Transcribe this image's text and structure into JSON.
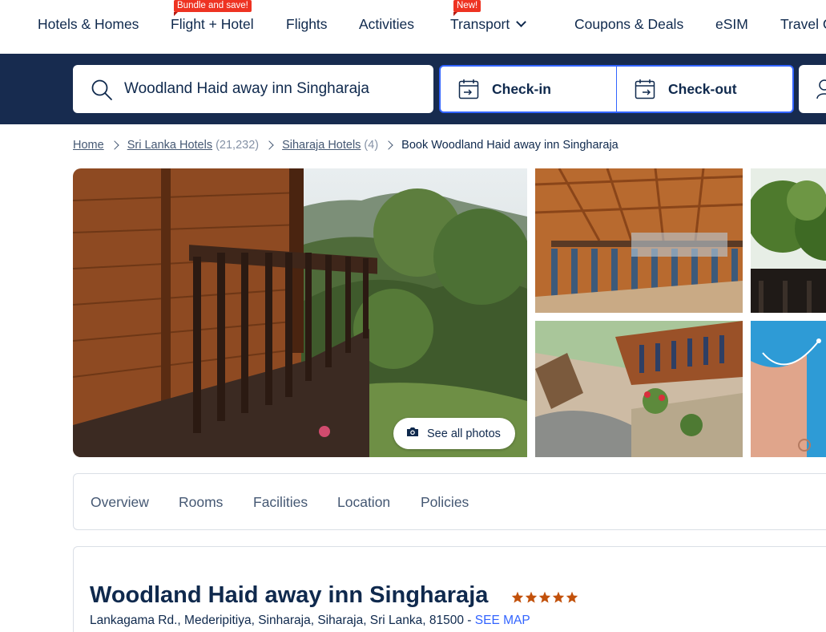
{
  "nav": {
    "items": [
      {
        "label": "Hotels & Homes"
      },
      {
        "label": "Flight + Hotel",
        "badge": "Bundle and save!"
      },
      {
        "label": "Flights"
      },
      {
        "label": "Activities"
      },
      {
        "label": "Transport",
        "badge": "New!"
      },
      {
        "label": "Coupons & Deals"
      },
      {
        "label": "eSIM"
      },
      {
        "label": "Travel C"
      }
    ]
  },
  "search": {
    "destination_value": "Woodland Haid away inn Singharaja",
    "checkin_label": "Check-in",
    "checkout_label": "Check-out"
  },
  "breadcrumb": {
    "home": "Home",
    "country": "Sri Lanka Hotels",
    "country_count": "(21,232)",
    "city": "Siharaja Hotels",
    "city_count": "(4)",
    "current": "Book Woodland Haid away inn Singharaja"
  },
  "gallery": {
    "see_all_label": "See all photos"
  },
  "tabs": [
    "Overview",
    "Rooms",
    "Facilities",
    "Location",
    "Policies"
  ],
  "hotel": {
    "name": "Woodland Haid away inn Singharaja",
    "star_rating": 5,
    "address": "Lankagama Rd., Mederipitiya, Sinharaja, Siharaja, Sri Lanka, 81500 - ",
    "see_map_label": "SEE MAP"
  },
  "colors": {
    "brand_dark": "#172b4f",
    "accent_blue": "#3264ff",
    "badge_red": "#ee3322",
    "star_orange": "#c2510b"
  }
}
